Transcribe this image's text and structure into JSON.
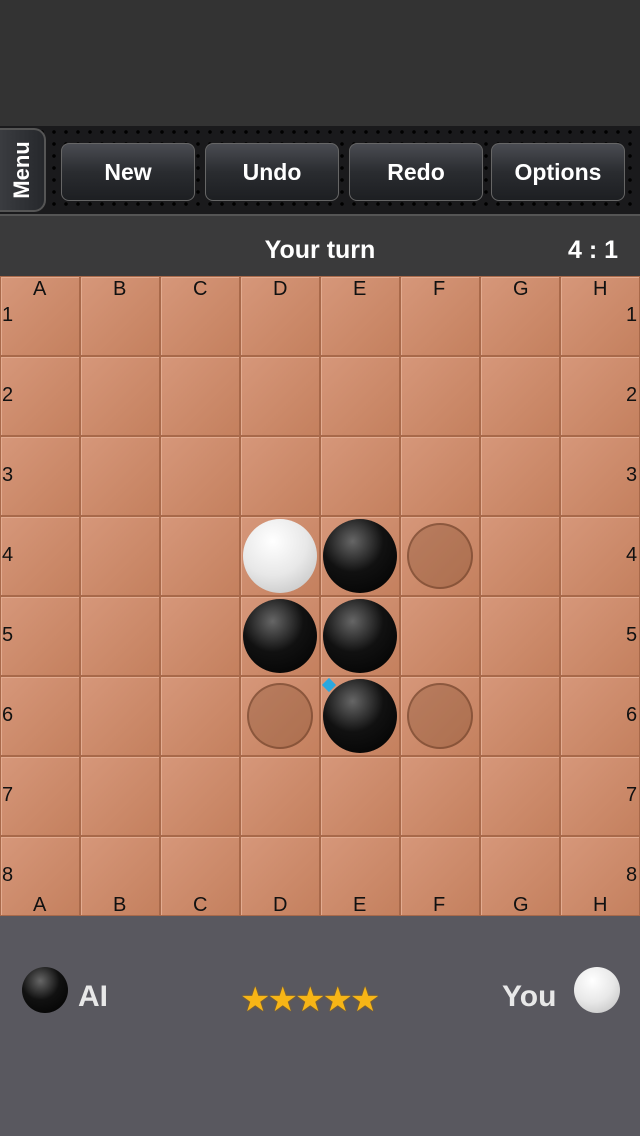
{
  "toolbar": {
    "menu": "Menu",
    "buttons": [
      "New",
      "Undo",
      "Redo",
      "Options"
    ]
  },
  "status": {
    "turn": "Your turn",
    "score": "4 : 1"
  },
  "board": {
    "columns": [
      "A",
      "B",
      "C",
      "D",
      "E",
      "F",
      "G",
      "H"
    ],
    "rows": [
      "1",
      "2",
      "3",
      "4",
      "5",
      "6",
      "7",
      "8"
    ],
    "discs": [
      {
        "cell": "D4",
        "color": "white"
      },
      {
        "cell": "E4",
        "color": "black"
      },
      {
        "cell": "D5",
        "color": "black"
      },
      {
        "cell": "E5",
        "color": "black"
      },
      {
        "cell": "E6",
        "color": "black"
      }
    ],
    "hints": [
      "F4",
      "D6",
      "F6"
    ],
    "last_move": "E6",
    "last_move_color": "#2aa8e0"
  },
  "players": {
    "left": {
      "label": "AI",
      "disc": "black"
    },
    "right": {
      "label": "You",
      "disc": "white"
    },
    "difficulty_stars": 5,
    "stars_text": "★★★★★"
  }
}
